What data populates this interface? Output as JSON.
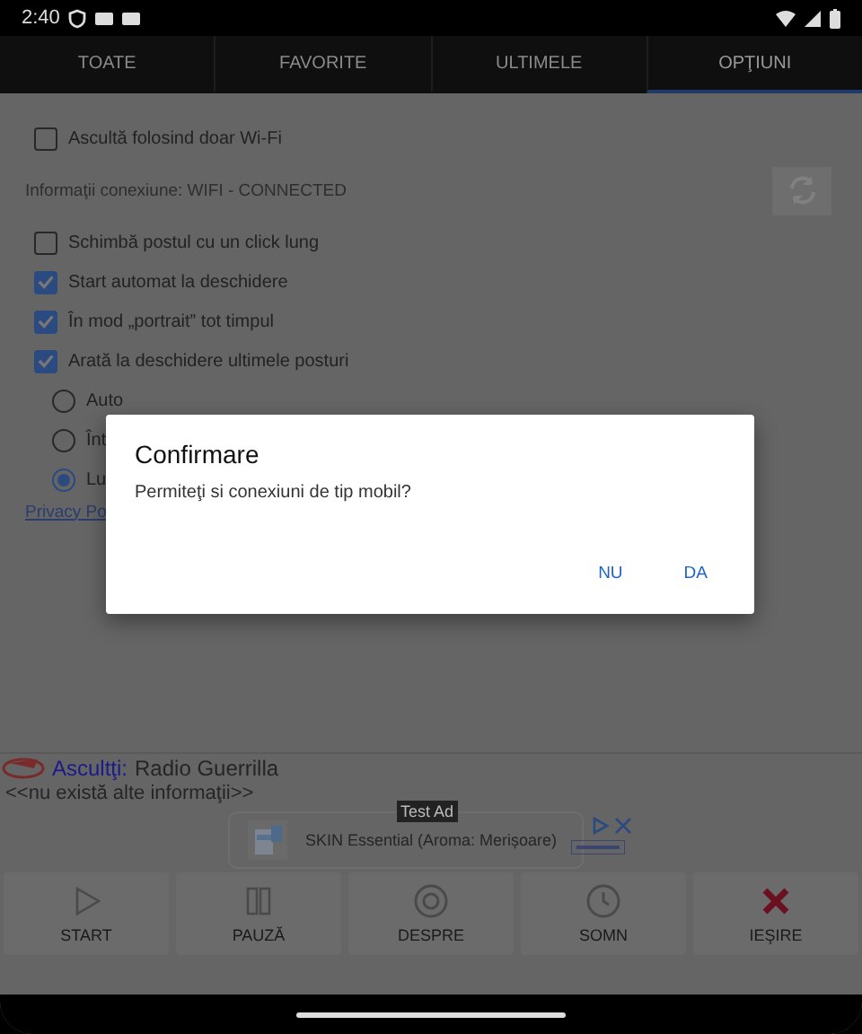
{
  "status_bar": {
    "time": "2:40"
  },
  "tabs": [
    {
      "label": "TOATE",
      "selected": false
    },
    {
      "label": "FAVORITE",
      "selected": false
    },
    {
      "label": "ULTIMELE",
      "selected": false
    },
    {
      "label": "OPŢIUNI",
      "selected": true
    }
  ],
  "options": [
    {
      "kind": "checkbox",
      "label": "Ascultă folosind doar Wi-Fi",
      "checked": false
    },
    {
      "kind": "info",
      "label": "Informaţii conexiune: WIFI - CONNECTED"
    },
    {
      "kind": "checkbox",
      "label": "Schimbă postul cu un click lung",
      "checked": false
    },
    {
      "kind": "checkbox",
      "label": "Start automat la deschidere",
      "checked": true
    },
    {
      "kind": "checkbox",
      "label": "În mod „portrait” tot timpul",
      "checked": true
    },
    {
      "kind": "checkbox",
      "label": "Arată la deschidere ultimele posturi",
      "checked": true
    },
    {
      "kind": "radio",
      "label": "Auto",
      "selected": false
    },
    {
      "kind": "radio",
      "label": "Înt",
      "selected": false
    },
    {
      "kind": "radio",
      "label": "Lu",
      "selected": true
    },
    {
      "kind": "link",
      "label": "Privacy Po"
    }
  ],
  "dialog": {
    "title": "Confirmare",
    "message": "Permiteţi si conexiuni de tip mobil?",
    "buttons": [
      "NU",
      "DA"
    ]
  },
  "now_playing": {
    "label": "Ascultţi:",
    "station": "Radio Guerrilla",
    "info": "<<nu există alte informaţii>>"
  },
  "ad": {
    "badge": "Test Ad",
    "text": "SKIN Essential (Aroma: Merișoare)"
  },
  "controls": [
    {
      "kind": "play",
      "label": "START"
    },
    {
      "kind": "pause",
      "label": "PAUZĂ"
    },
    {
      "kind": "info",
      "label": "DESPRE"
    },
    {
      "kind": "clock",
      "label": "SOMN"
    },
    {
      "kind": "exit",
      "label": "IEŞIRE"
    }
  ]
}
